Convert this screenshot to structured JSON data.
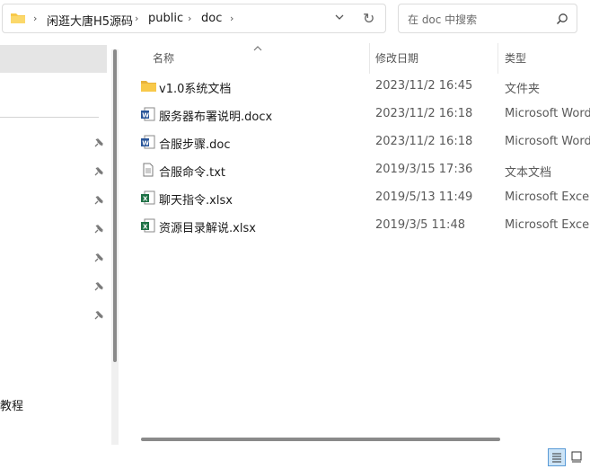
{
  "address_bar": {
    "breadcrumbs": [
      "闲逛大唐H5源码",
      "public",
      "doc"
    ]
  },
  "search": {
    "placeholder": "在 doc 中搜索"
  },
  "nav": {
    "partial_item": "教程"
  },
  "columns": {
    "name": "名称",
    "modified": "修改日期",
    "type": "类型"
  },
  "files": [
    {
      "name": "v1.0系统文档",
      "modified": "2023/11/2 16:45",
      "type": "文件夹",
      "icon": "folder-icon"
    },
    {
      "name": "服务器布署说明.docx",
      "modified": "2023/11/2 16:18",
      "type": "Microsoft Word",
      "icon": "word-icon"
    },
    {
      "name": "合服步骤.doc",
      "modified": "2023/11/2 16:18",
      "type": "Microsoft Word",
      "icon": "word-icon"
    },
    {
      "name": "合服命令.txt",
      "modified": "2019/3/15 17:36",
      "type": "文本文档",
      "icon": "text-file-icon"
    },
    {
      "name": "聊天指令.xlsx",
      "modified": "2019/5/13 11:49",
      "type": "Microsoft Excel",
      "icon": "excel-icon"
    },
    {
      "name": "资源目录解说.xlsx",
      "modified": "2019/3/5 11:48",
      "type": "Microsoft Excel",
      "icon": "excel-icon"
    }
  ],
  "colors": {
    "folder": "#f8c94a",
    "word": "#2b579a",
    "excel": "#1e7145",
    "selection": "#e5e5e5"
  }
}
